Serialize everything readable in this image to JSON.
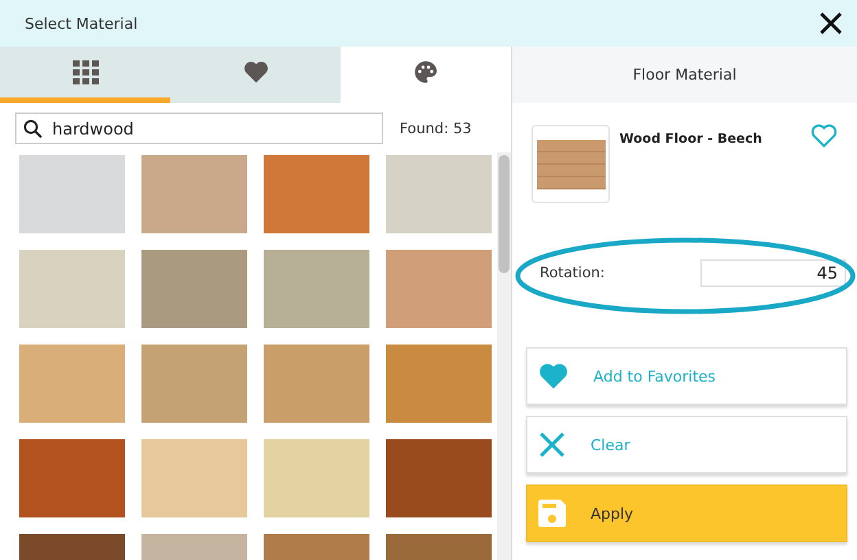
{
  "window": {
    "title": "Select Material"
  },
  "tabs": [
    {
      "kind": "grid",
      "selected": true,
      "highlighted": false
    },
    {
      "kind": "heart",
      "selected": false,
      "highlighted": false
    },
    {
      "kind": "palette",
      "selected": false,
      "highlighted": true
    }
  ],
  "search": {
    "value": "hardwood",
    "found": "Found: 53"
  },
  "swatches": [
    {
      "color": "#d8dadb"
    },
    {
      "color": "#c9a98a"
    },
    {
      "color": "#d0773a"
    },
    {
      "color": "#d6d2c6"
    },
    {
      "color": "#d9d2bf"
    },
    {
      "color": "#a99a80"
    },
    {
      "color": "#b8b096"
    },
    {
      "color": "#d09f7a"
    },
    {
      "color": "#d9ae78"
    },
    {
      "color": "#c4a274"
    },
    {
      "color": "#c99e68"
    },
    {
      "color": "#c98b3f"
    },
    {
      "color": "#b2521e"
    },
    {
      "color": "#e6c89a"
    },
    {
      "color": "#e3d2a2"
    },
    {
      "color": "#9a4b1e"
    },
    {
      "color": "#7a4a2a"
    },
    {
      "color": "#c4b4a0"
    },
    {
      "color": "#b07d4a"
    },
    {
      "color": "#9a6a3a"
    }
  ],
  "details": {
    "header": "Floor Material",
    "material_name": "Wood Floor - Beech",
    "favorite": false,
    "rotation_label": "Rotation:",
    "rotation_value": "45"
  },
  "buttons": [
    {
      "kind": "favorite",
      "label": "Add to Favorites"
    },
    {
      "kind": "clear",
      "label": "Clear"
    },
    {
      "kind": "apply",
      "label": "Apply"
    }
  ]
}
